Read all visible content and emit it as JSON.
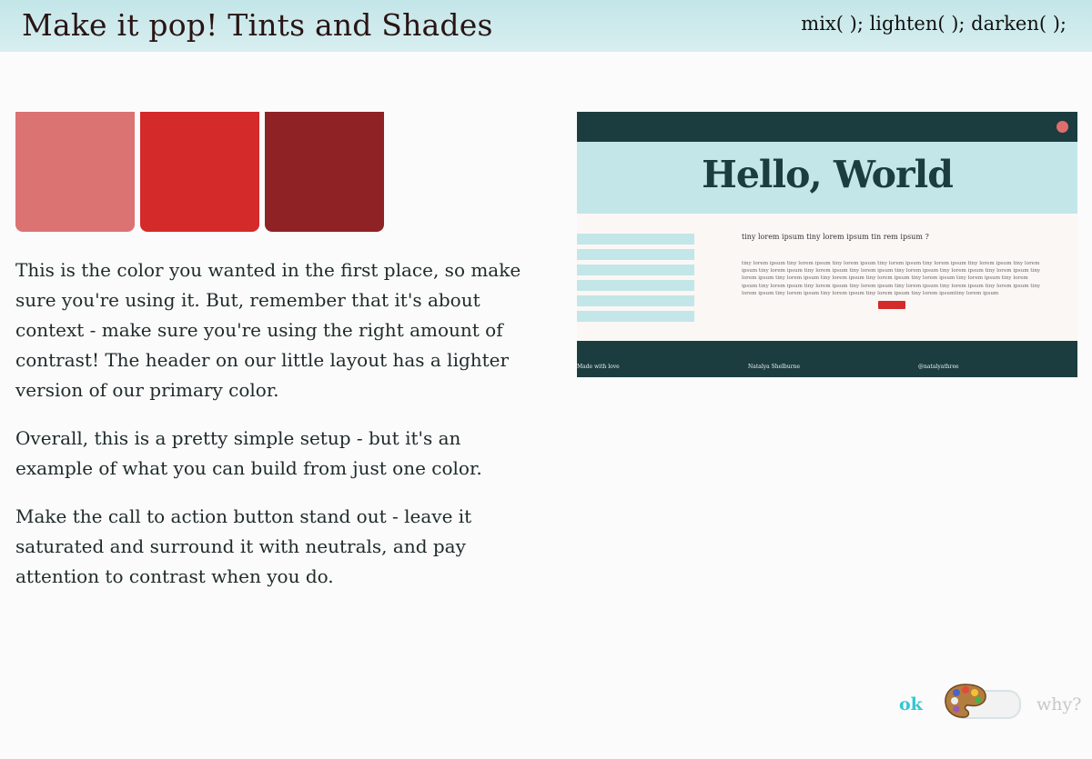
{
  "header": {
    "title": "Make it pop! Tints and Shades",
    "functions": "mix( ); lighten( ); darken( );"
  },
  "swatches": {
    "tint": "#db7372",
    "base": "#d42a2a",
    "shade": "#8f2224"
  },
  "content": {
    "paragraphs": [
      "This is the color you wanted in the first place, so make sure you're using it. But, remember that it's about context - make sure you're using the right amount of contrast! The header on our little layout has a lighter version of our primary color.",
      "Overall, this is a pretty simple setup - but it's an example of what you can build from just one color.",
      "Make the call to action button stand out - leave it saturated and surround it with neutrals, and pay attention to contrast when you do."
    ]
  },
  "preview": {
    "headline": "Hello, World",
    "heading": "tiny lorem ipsum tiny lorem ipsum tin rem ipsum ?",
    "body": "tiny lorem ipsum tiny lorem ipsum tiny lorem ipsum tiny lorem ipsum tiny lorem ipsum tiny lorem ipsum tiny lorem ipsum tiny lorem ipsum tiny lorem ipsum tiny lorem ipsum tiny lorem ipsum tiny lorem ipsum tiny lorem ipsum tiny lorem ipsum tiny lorem ipsum tiny lorem ipsum tiny lorem ipsum tiny lorem ipsum tiny lorem ipsum tiny lorem ipsum tiny lorem ipsum tiny lorem ipsum tiny lorem ipsum tiny lorem ipsum tiny lorem ipsum tiny lorem ipsum tiny lorem ipsum tiny lorem ipsum tiny lorem ipsum tiny lorem ipsum tiny lorem ipsumtiny lorem ipsum",
    "footer": {
      "left": "Made with love",
      "center": "Natalya Shelburne",
      "right": "@natalyathree"
    }
  },
  "controls": {
    "ok": "ok",
    "why": "why?",
    "toggle_icon": "palette-icon"
  }
}
